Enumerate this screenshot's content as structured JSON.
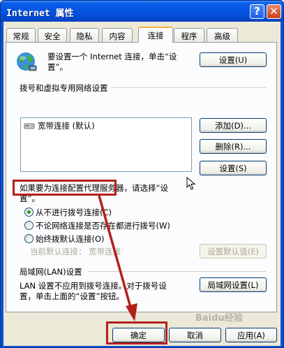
{
  "window": {
    "title": "Internet 属性",
    "help_label": "?",
    "close_label": "✕"
  },
  "tabs": [
    {
      "label": "常规"
    },
    {
      "label": "安全"
    },
    {
      "label": "隐私"
    },
    {
      "label": "内容"
    },
    {
      "label": "连接"
    },
    {
      "label": "程序"
    },
    {
      "label": "高级"
    }
  ],
  "setup": {
    "icon": "globe-network-icon",
    "text": "要设置一个 Internet 连接，单击“设置”。",
    "button": "设置(U)"
  },
  "dialup": {
    "heading": "拨号和虚拟专用网络设置",
    "list_items": [
      "宽带连接 (默认)"
    ],
    "list_item_icon": "dialup-connection-icon",
    "add_button": "添加(D)...",
    "remove_button": "删除(R)...",
    "settings_button": "设置(S)",
    "proxy_hint": "如果要为连接配置代理服务器，请选择“设置”。",
    "options": [
      {
        "label": "从不进行拨号连接(C)",
        "checked": true
      },
      {
        "label": "不论网络连接是否存在都进行拨号(W)",
        "checked": false
      },
      {
        "label": "始终拨默认连接(O)",
        "checked": false
      }
    ],
    "current_default_label": "当前默认连接：",
    "current_default_value": "宽带连接",
    "set_default_button": "设置默认值(E)"
  },
  "lan": {
    "heading": "局域网(LAN)设置",
    "text_line1": "LAN 设置不应用到拨号连接。对于拨号设",
    "text_line2": "置，单击上面的“设置”按钮。",
    "button": "局域网设置(L)"
  },
  "footer": {
    "ok_button": "确定",
    "cancel_button": "取消",
    "apply_button": "应用(A)"
  },
  "watermark": "Baidu经验",
  "colors": {
    "highlight": "#b3201b",
    "titlebar": "#0454e2",
    "dialog_bg": "#ece9d8"
  }
}
